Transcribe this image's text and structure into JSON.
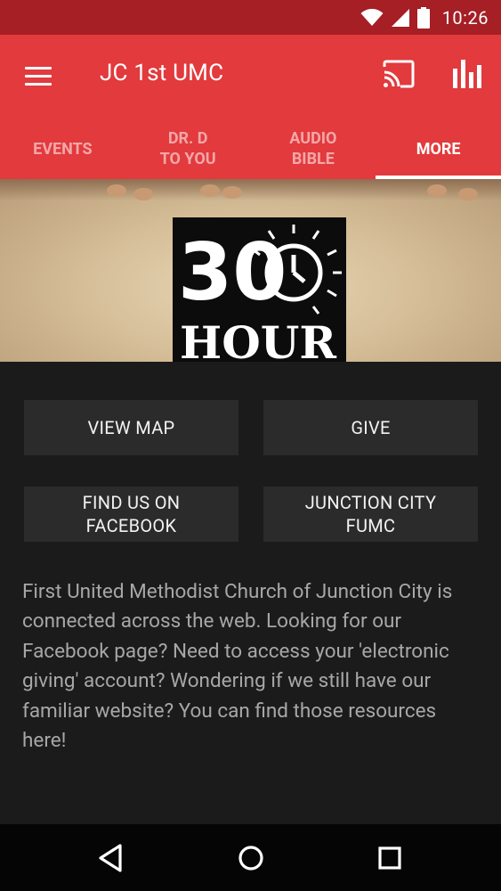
{
  "status_bar": {
    "time": "10:26"
  },
  "app_bar": {
    "title": "JC 1st UMC"
  },
  "tabs": [
    {
      "label": "EVENTS"
    },
    {
      "label": "DR. D\nTO YOU"
    },
    {
      "label": "AUDIO\nBIBLE"
    },
    {
      "label": "MORE"
    }
  ],
  "banner": {
    "logo_top": "30",
    "logo_bottom": "HOUR"
  },
  "buttons": {
    "view_map": "VIEW MAP",
    "give": "GIVE",
    "facebook": "FIND US ON\nFACEBOOK",
    "junction": "JUNCTION CITY\nFUMC"
  },
  "description": "First United Methodist Church of Junction City is connected across the web. Looking for our Facebook page? Need to access your 'electronic giving' account? Wondering if we still have our familiar website? You can find those resources here!",
  "colors": {
    "accent": "#e23a3d",
    "status_bar": "#a51f25",
    "background": "#1b1b1c"
  },
  "icons": [
    "wifi-icon",
    "cell-signal-icon",
    "battery-icon",
    "menu-icon",
    "cast-icon",
    "bar-chart-icon",
    "back-icon",
    "home-icon",
    "recents-icon"
  ]
}
